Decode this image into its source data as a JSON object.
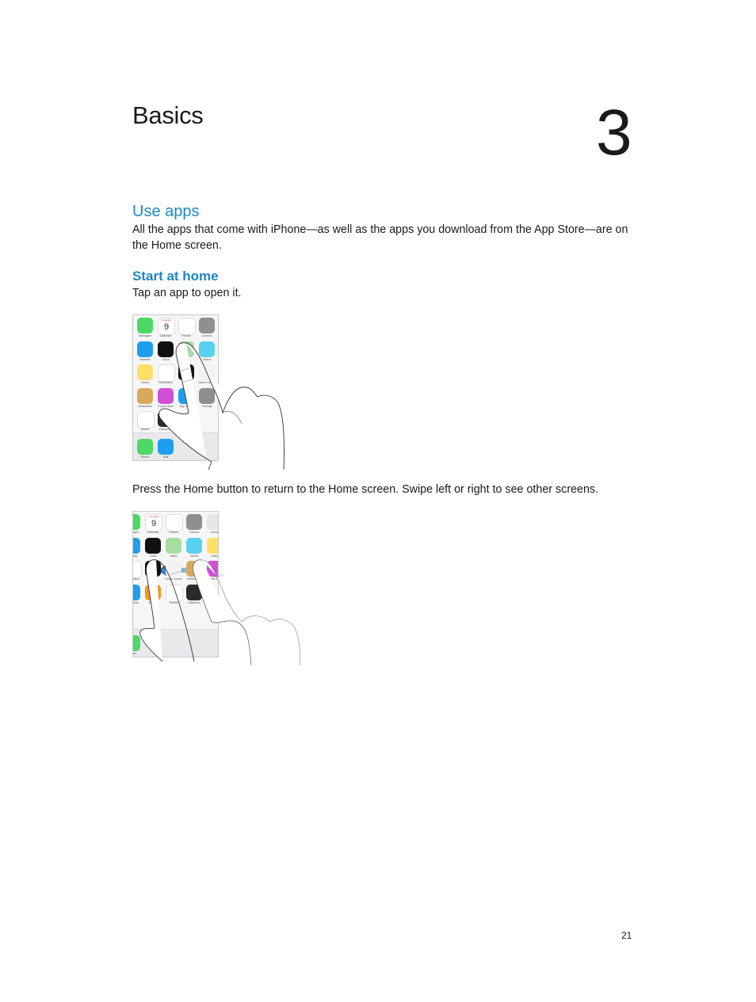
{
  "chapter": {
    "title": "Basics",
    "number": "3"
  },
  "sections": {
    "use_apps": {
      "heading": "Use apps",
      "body": "All the apps that come with iPhone—as well as the apps you download from the App Store—are on the Home screen."
    },
    "start_at_home": {
      "heading": "Start at home",
      "body": "Tap an app to open it."
    },
    "press_home": {
      "body": "Press the Home button to return to the Home screen. Swipe left or right to see other screens."
    }
  },
  "figure1": {
    "description": "Finger tapping an app on the iPhone Home screen",
    "apps": [
      {
        "label": "Messages",
        "icon": "messages-icon",
        "color": "#4cd964"
      },
      {
        "label": "Calendar",
        "icon": "calendar-icon",
        "color": "#ffffff",
        "day": "Tuesday",
        "date": "9"
      },
      {
        "label": "Photos",
        "icon": "photos-icon",
        "color": "#ffffff"
      },
      {
        "label": "Camera",
        "icon": "camera-icon",
        "color": "#8e8e93"
      },
      {
        "label": "Weather",
        "icon": "weather-icon",
        "color": "#1e9ef0"
      },
      {
        "label": "Clock",
        "icon": "clock-icon",
        "color": "#111111"
      },
      {
        "label": "Maps",
        "icon": "maps-icon",
        "color": "#a7dca2"
      },
      {
        "label": "Videos",
        "icon": "videos-icon",
        "color": "#5ad0f0"
      },
      {
        "label": "Notes",
        "icon": "notes-icon",
        "color": "#ffe066"
      },
      {
        "label": "Reminders",
        "icon": "reminders-icon",
        "color": "#ffffff"
      },
      {
        "label": "Stocks",
        "icon": "stocks-icon",
        "color": "#111111"
      },
      {
        "label": "Game Center",
        "icon": "game-center-icon",
        "color": "#f2f2f2"
      },
      {
        "label": "Newsstand",
        "icon": "newsstand-icon",
        "color": "#d9a85c"
      },
      {
        "label": "iTunes Store",
        "icon": "itunes-store-icon",
        "color": "#d04fd8"
      },
      {
        "label": "App Store",
        "icon": "app-store-icon",
        "color": "#1e9ef0"
      },
      {
        "label": "Settings",
        "icon": "settings-icon",
        "color": "#8e8e93"
      },
      {
        "label": "Health",
        "icon": "health-icon",
        "color": "#ffffff"
      },
      {
        "label": "Passbook",
        "icon": "passbook-icon",
        "color": "#2a2a2a"
      }
    ],
    "dock": [
      {
        "label": "Phone",
        "icon": "phone-icon",
        "color": "#4cd964"
      },
      {
        "label": "Mail",
        "icon": "mail-icon",
        "color": "#1e9ef0"
      }
    ]
  },
  "figure2": {
    "description": "Finger swiping left on the Home screen",
    "apps": [
      {
        "label": "Messages",
        "icon": "messages-icon",
        "color": "#4cd964"
      },
      {
        "label": "Calendar",
        "icon": "calendar-icon",
        "color": "#ffffff",
        "day": "Tuesday",
        "date": "9"
      },
      {
        "label": "Photos",
        "icon": "photos-icon",
        "color": "#ffffff"
      },
      {
        "label": "Camera",
        "icon": "camera-icon",
        "color": "#8e8e93"
      },
      {
        "label": "Extras",
        "icon": "extras-icon",
        "color": "#e6e6e6"
      },
      {
        "label": "Weather",
        "icon": "weather-icon",
        "color": "#1e9ef0"
      },
      {
        "label": "Clock",
        "icon": "clock-icon",
        "color": "#111111"
      },
      {
        "label": "Maps",
        "icon": "maps-icon",
        "color": "#a7dca2"
      },
      {
        "label": "Videos",
        "icon": "videos-icon",
        "color": "#5ad0f0"
      },
      {
        "label": "Notes",
        "icon": "notes-icon",
        "color": "#ffe066"
      },
      {
        "label": "Reminders",
        "icon": "reminders-icon",
        "color": "#ffffff"
      },
      {
        "label": "Stocks",
        "icon": "stocks-icon",
        "color": "#111111"
      },
      {
        "label": "Game Center",
        "icon": "game-center-icon",
        "color": "#f2f2f2"
      },
      {
        "label": "Newsstand",
        "icon": "newsstand-icon",
        "color": "#d9a85c"
      },
      {
        "label": "iTunes Store",
        "icon": "itunes-store-icon",
        "color": "#d04fd8"
      },
      {
        "label": "App Store",
        "icon": "app-store-icon",
        "color": "#1e9ef0"
      },
      {
        "label": "iBooks",
        "icon": "ibooks-icon",
        "color": "#f7941d"
      },
      {
        "label": "Health",
        "icon": "health-icon",
        "color": "#ffffff"
      },
      {
        "label": "Passbook",
        "icon": "passbook-icon",
        "color": "#2a2a2a"
      }
    ],
    "dock": [
      {
        "label": "Phone",
        "icon": "phone-icon",
        "color": "#4cd964"
      }
    ],
    "gesture": "swipe-left-arrow"
  },
  "footer": {
    "page_number": "21"
  },
  "colors": {
    "heading_blue": "#1a87c9",
    "text": "#1a1a1a"
  }
}
